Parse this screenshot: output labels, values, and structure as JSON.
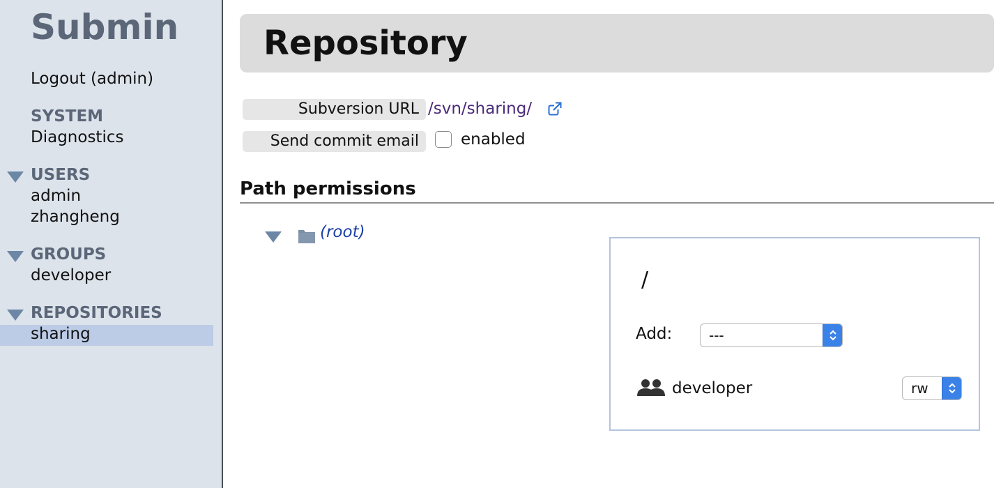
{
  "app": {
    "name": "Submin"
  },
  "sidebar": {
    "logout": "Logout (admin)",
    "system": {
      "heading": "SYSTEM",
      "items": [
        "Diagnostics"
      ]
    },
    "users": {
      "heading": "USERS",
      "items": [
        "admin",
        "zhangheng"
      ]
    },
    "groups": {
      "heading": "GROUPS",
      "items": [
        "developer"
      ]
    },
    "repositories": {
      "heading": "REPOSITORIES",
      "items": [
        "sharing"
      ],
      "selected": "sharing"
    }
  },
  "main": {
    "title": "Repository",
    "subversion_url_label": "Subversion URL",
    "subversion_url": "/svn/sharing/",
    "commit_email_label": "Send commit email",
    "commit_email_enabled": false,
    "commit_email_checkbox_label": "enabled",
    "path_permissions_heading": "Path permissions",
    "tree": {
      "root_label": "(root)"
    },
    "panel": {
      "path": "/",
      "add_label": "Add:",
      "add_selected": "---",
      "permissions": [
        {
          "type": "group",
          "name": "developer",
          "access": "rw"
        }
      ]
    }
  },
  "icons": {
    "external_link": "external-link-icon",
    "folder": "folder-icon",
    "group": "group-icon",
    "tree_toggle": "triangle-down-icon"
  },
  "colors": {
    "sidebar_bg": "#dde3eb",
    "section_heading": "#5b6779",
    "selected_row": "#bccbe6",
    "link_purple": "#4b2a7a",
    "link_blue": "#1a3fa8",
    "select_accent": "#3b82e8"
  }
}
